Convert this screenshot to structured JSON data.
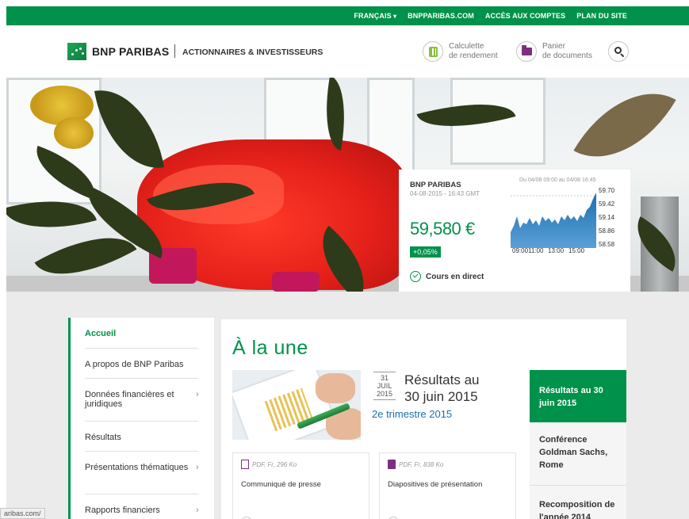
{
  "topbar": {
    "language": "FRANÇAIS",
    "site_link": "BNPPARIBAS.COM",
    "accounts_link": "ACCÈS AUX COMPTES",
    "sitemap_link": "PLAN DU SITE"
  },
  "header": {
    "brand": "BNP PARIBAS",
    "section": "ACTIONNAIRES & INVESTISSEURS",
    "calculator_label_1": "Calculette",
    "calculator_label_2": "de rendement",
    "basket_label_1": "Panier",
    "basket_label_2": "de documents",
    "icons": [
      "calculator-icon",
      "folder-icon",
      "search-icon"
    ]
  },
  "stock": {
    "name": "BNP PARIBAS",
    "datetime": "04-08-2015 - 16:43 GMT",
    "price": "59,580 €",
    "change": "+0,05%",
    "live_label": "Cours en direct",
    "range_label": "Du 04/08 09:00 au 04/08 16:45",
    "y_ticks": [
      "59.70",
      "59.42",
      "59.14",
      "58.86",
      "58.58"
    ],
    "x_ticks": [
      "09:00",
      "11:00",
      "13:00",
      "15:00"
    ],
    "accent": "#00914a"
  },
  "sidebar": {
    "items": [
      {
        "label": "Accueil"
      },
      {
        "label": "A propos de BNP Paribas"
      },
      {
        "label": "Données financières et juridiques"
      },
      {
        "label": "Résultats"
      },
      {
        "label": "Présentations thématiques"
      },
      {
        "label": "Rapports financiers"
      }
    ]
  },
  "main": {
    "title": "À la une",
    "article": {
      "day": "31",
      "month": "JUIL",
      "year": "2015",
      "title_line1": "Résultats au",
      "title_line2": "30 juin 2015",
      "subtitle": "2e trimestre 2015"
    },
    "docs": [
      {
        "meta": "PDF, Fr, 296 Ko",
        "title": "Communiqué de presse"
      },
      {
        "meta": "PDF, Fr, 838 Ko",
        "title": "Diapositives de présentation"
      }
    ],
    "tabs": [
      {
        "label": "Résultats au 30 juin 2015"
      },
      {
        "label": "Conférence Goldman Sachs, Rome"
      },
      {
        "label": "Recomposition de l'année 2014"
      }
    ]
  },
  "statusbar": {
    "url": "aribas.com/"
  }
}
